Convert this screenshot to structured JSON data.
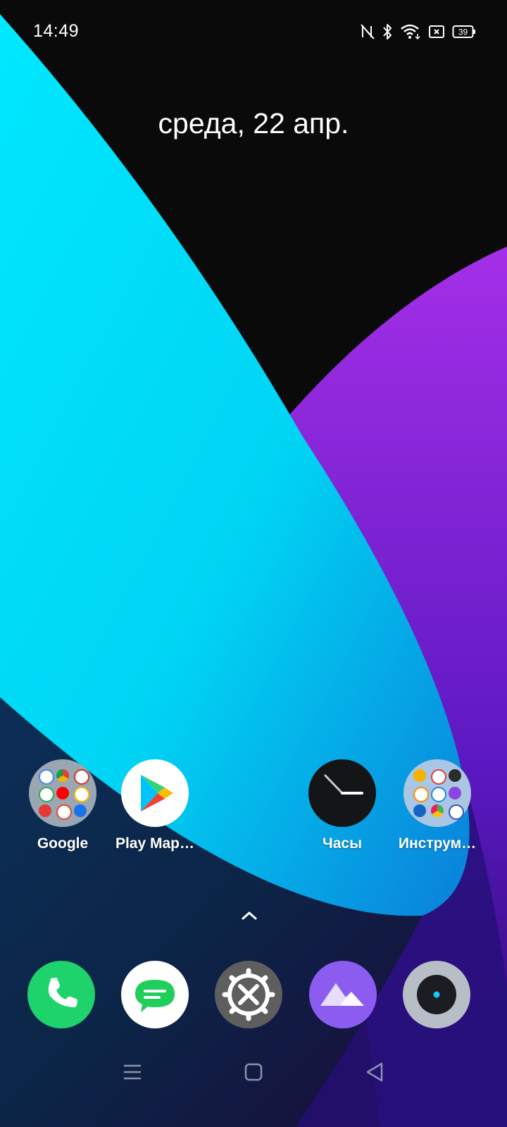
{
  "status_bar": {
    "time": "14:49",
    "battery_level": "39",
    "icons": [
      "nfc-icon",
      "bluetooth-icon",
      "wifi-icon",
      "no-sim-icon",
      "battery-icon"
    ]
  },
  "date_widget": {
    "text": "среда, 22 апр."
  },
  "home_apps": [
    {
      "label": "Google",
      "icon": "google-folder-icon"
    },
    {
      "label": "Play Map…",
      "icon": "play-store-icon"
    },
    {
      "label": "Часы",
      "icon": "clock-icon"
    },
    {
      "label": "Инструм…",
      "icon": "tools-folder-icon"
    }
  ],
  "dock": [
    {
      "icon": "phone-icon",
      "color": "#1ED36B"
    },
    {
      "icon": "messages-icon",
      "color": "#FFFFFF"
    },
    {
      "icon": "settings-icon",
      "color": "#5E5E5E"
    },
    {
      "icon": "gallery-icon",
      "color": "#8C5CF0"
    },
    {
      "icon": "camera-icon",
      "color": "#B8BEC6"
    }
  ],
  "navigation": [
    "menu-icon",
    "home-icon",
    "back-icon"
  ],
  "colors": {
    "wallpaper_cyan": "#00E5FF",
    "wallpaper_purple": "#8A2BE2",
    "wallpaper_navy": "#0F2A4A"
  }
}
